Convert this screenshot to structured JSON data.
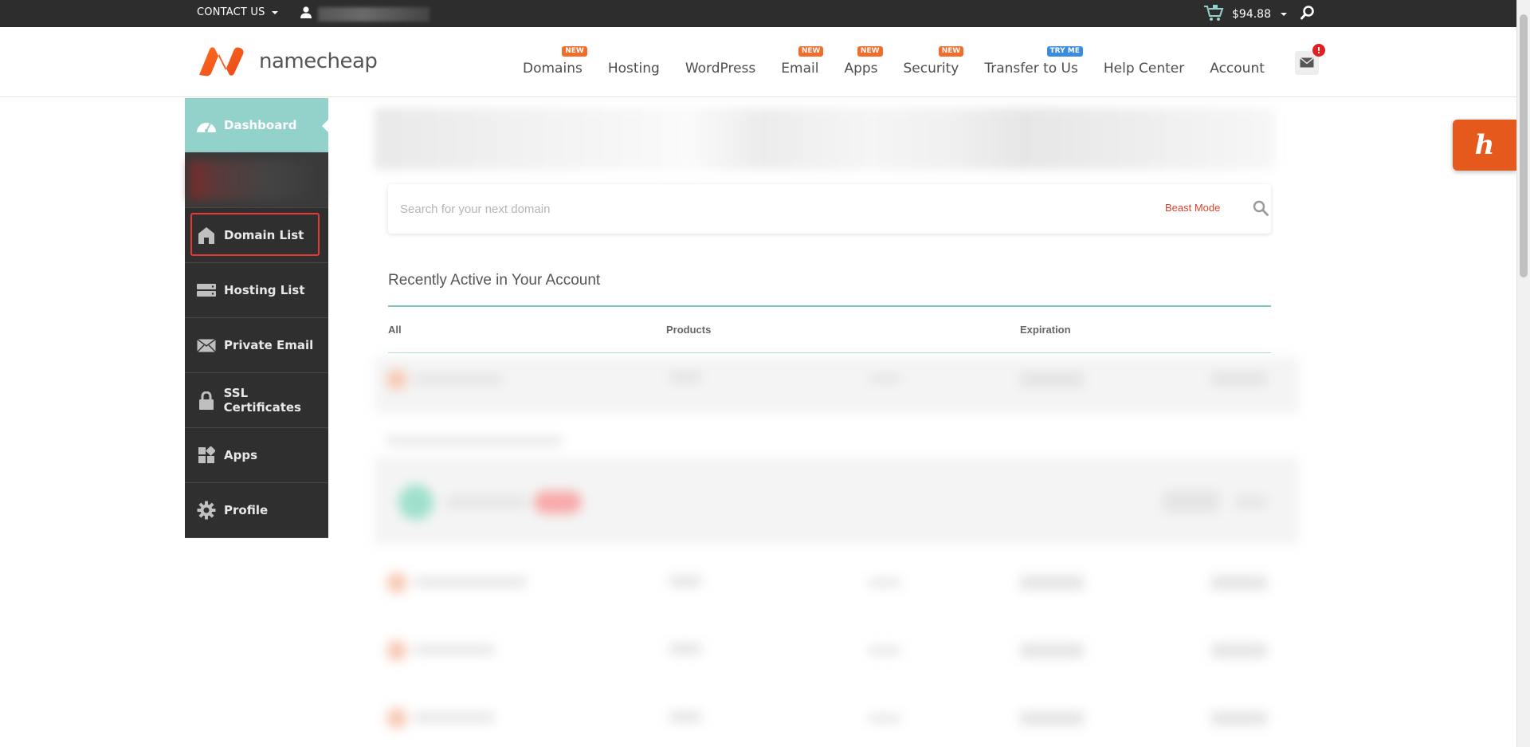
{
  "topbar": {
    "contact_label": "CONTACT US",
    "cart_amount": "$94.88"
  },
  "header": {
    "logo_text": "namecheap",
    "nav": [
      {
        "label": "Domains",
        "badge": "NEW"
      },
      {
        "label": "Hosting",
        "badge": ""
      },
      {
        "label": "WordPress",
        "badge": ""
      },
      {
        "label": "Email",
        "badge": "NEW"
      },
      {
        "label": "Apps",
        "badge": "NEW"
      },
      {
        "label": "Security",
        "badge": "NEW"
      },
      {
        "label": "Transfer to Us",
        "badge": "TRY ME"
      },
      {
        "label": "Help Center",
        "badge": ""
      },
      {
        "label": "Account",
        "badge": ""
      }
    ],
    "mail_alert": "!"
  },
  "sidebar": {
    "items": [
      {
        "label": "Dashboard",
        "icon": "dashboard-icon"
      },
      {
        "label": "Domain List",
        "icon": "home-icon"
      },
      {
        "label": "Hosting List",
        "icon": "server-icon"
      },
      {
        "label": "Private Email",
        "icon": "envelope-icon"
      },
      {
        "label": "SSL Certificates",
        "icon": "lock-icon"
      },
      {
        "label": "Apps",
        "icon": "apps-icon"
      },
      {
        "label": "Profile",
        "icon": "gear-icon"
      }
    ]
  },
  "main": {
    "search_placeholder": "Search for your next domain",
    "beast_mode_label": "Beast Mode",
    "recent_title": "Recently Active in Your Account",
    "columns": [
      "All",
      "Products",
      "Expiration"
    ]
  },
  "colors": {
    "topbar": "#2d2d2d",
    "sidebar": "#2f2f2f",
    "sidebar_active": "#93d1cb",
    "accent_orange": "#f26c2a",
    "highlight_red": "#e53935",
    "teal_rule": "#7fc6c0"
  }
}
